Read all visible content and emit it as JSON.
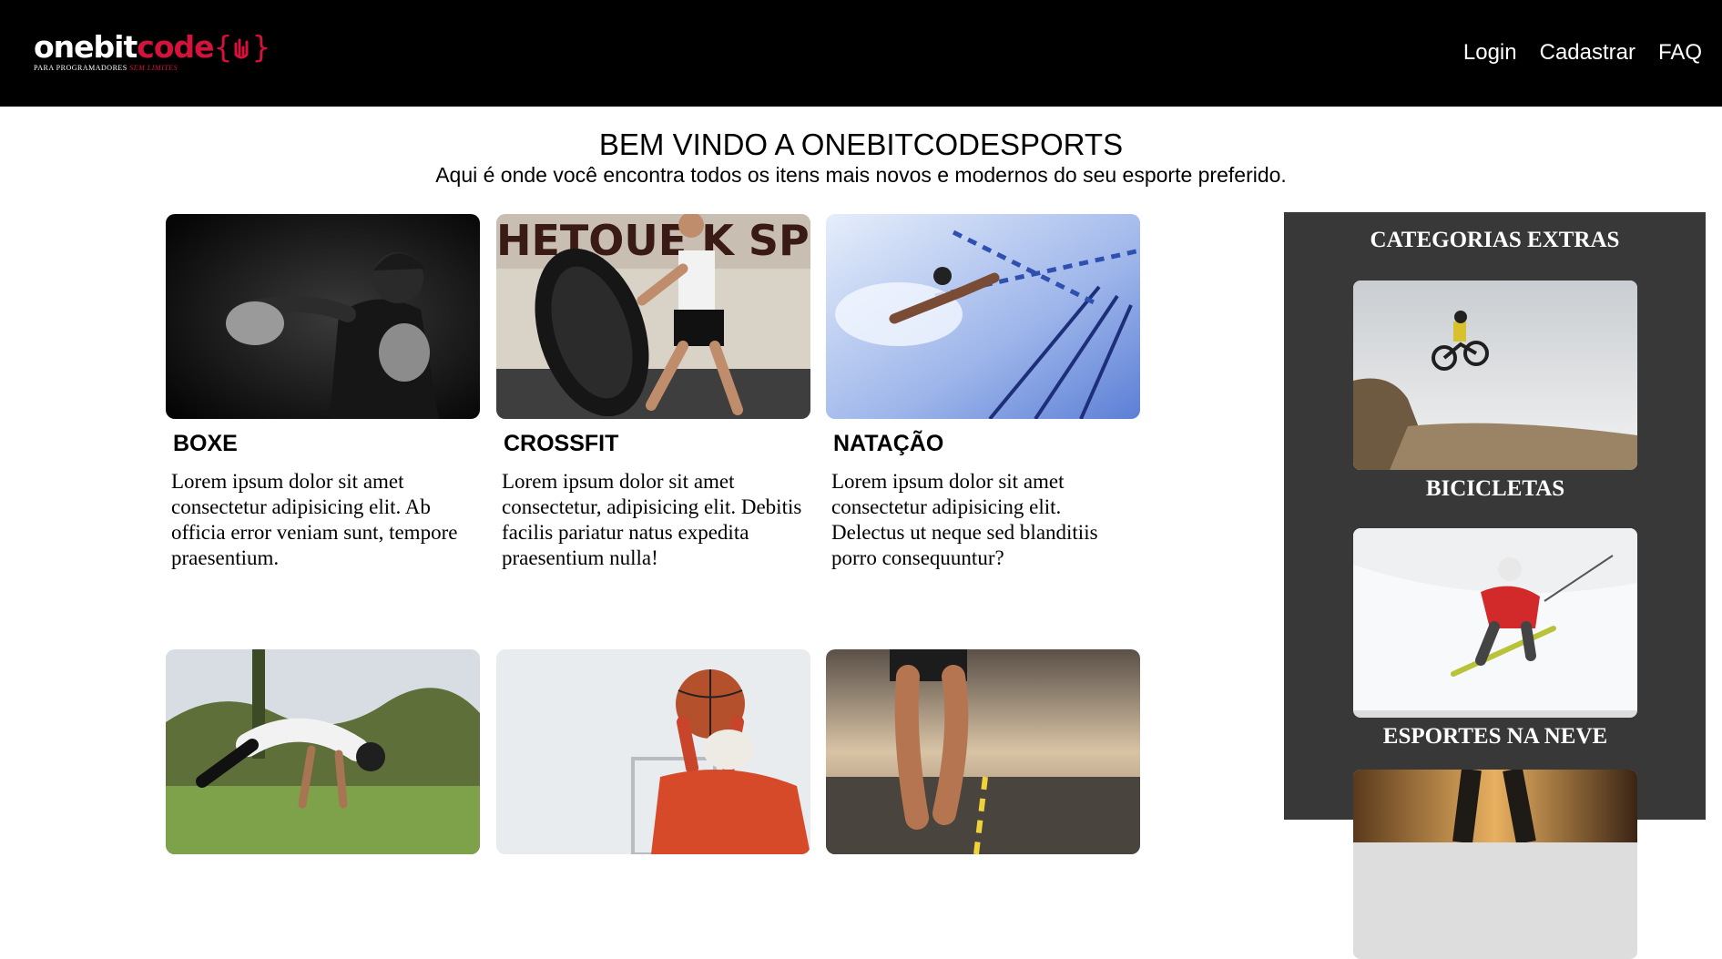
{
  "header": {
    "logo": {
      "part1": "onebit",
      "part2": "code",
      "tagline_white": "PARA PROGRAMADORES",
      "tagline_red": "SEM LIMITES"
    },
    "nav": [
      "Login",
      "Cadastrar",
      "FAQ"
    ]
  },
  "welcome": {
    "title": "BEM VINDO A ONEBITCODESPORTS",
    "subtitle": "Aqui é onde você encontra todos os itens mais novos e modernos do seu esporte preferido."
  },
  "cards": [
    {
      "title": "BOXE",
      "text": "Lorem ipsum dolor sit amet consectetur adipisicing elit. Ab officia error veniam sunt, tempore praesentium."
    },
    {
      "title": "CROSSFIT",
      "text": "Lorem ipsum dolor sit amet consectetur, adipisicing elit. Debitis facilis pariatur natus expedita praesentium nulla!"
    },
    {
      "title": "NATAÇÃO",
      "text": "Lorem ipsum dolor sit amet consectetur adipisicing elit. Delectus ut neque sed blanditiis porro consequuntur?"
    },
    {
      "image": "calisthenics"
    },
    {
      "image": "basketball"
    },
    {
      "image": "running"
    }
  ],
  "sidebar": {
    "title": "CATEGORIAS EXTRAS",
    "items": [
      {
        "label": "BICICLETAS"
      },
      {
        "label": "ESPORTES NA NEVE"
      },
      {
        "label": ""
      }
    ]
  }
}
